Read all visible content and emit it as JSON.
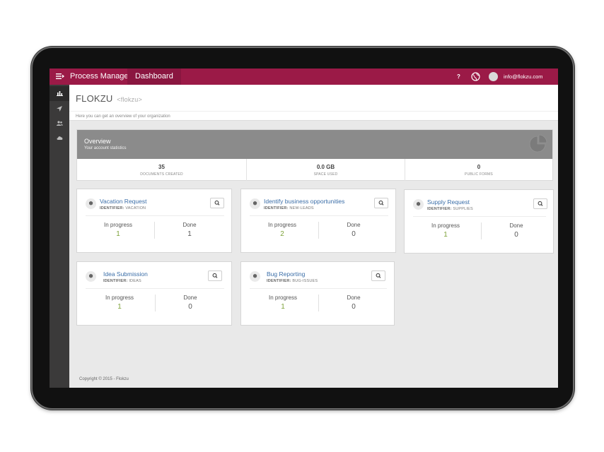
{
  "topbar": {
    "brand": "Process Manager",
    "nav_dashboard": "Dashboard",
    "help_label": "?",
    "user_email": "info@flokzu.com"
  },
  "sidebar": {
    "items": [
      {
        "icon": "bar-chart-icon",
        "glyph": "▥"
      },
      {
        "icon": "send-icon",
        "glyph": "➤"
      },
      {
        "icon": "users-icon",
        "glyph": "👥"
      },
      {
        "icon": "cloud-icon",
        "glyph": "☁"
      }
    ]
  },
  "header": {
    "org_name": "FLOKZU",
    "org_handle": "<flokzu>",
    "description": "Here you can get an overview of your organization"
  },
  "overview": {
    "title": "Overview",
    "subtitle": "Your account statistics",
    "stats": [
      {
        "value": "35",
        "label": "DOCUMENTS CREATED"
      },
      {
        "value": "0.0 GB",
        "label": "SPACE USED"
      },
      {
        "value": "0",
        "label": "PUBLIC FORMS"
      }
    ]
  },
  "processes": [
    {
      "title": "Vacation Request",
      "identifier_label": "IDENTIFIER:",
      "identifier": "VACATION",
      "in_progress_label": "In progress",
      "in_progress": "1",
      "done_label": "Done",
      "done": "1"
    },
    {
      "title": "Identify business opportunities",
      "identifier_label": "IDENTIFIER:",
      "identifier": "NEW-LEADS",
      "in_progress_label": "In progress",
      "in_progress": "2",
      "done_label": "Done",
      "done": "0"
    },
    {
      "title": "Supply Request",
      "identifier_label": "IDENTIFIER:",
      "identifier": "SUPPLIES",
      "in_progress_label": "In progress",
      "in_progress": "1",
      "done_label": "Done",
      "done": "0"
    },
    {
      "title": "Idea Submission",
      "identifier_label": "IDENTIFIER:",
      "identifier": "IDEAS",
      "in_progress_label": "In progress",
      "in_progress": "1",
      "done_label": "Done",
      "done": "0"
    },
    {
      "title": "Bug Reporting",
      "identifier_label": "IDENTIFIER:",
      "identifier": "BUG-ISSUES",
      "in_progress_label": "In progress",
      "in_progress": "1",
      "done_label": "Done",
      "done": "0"
    }
  ],
  "footer": {
    "copyright": "Copyright © 2015 - Flokzu"
  },
  "colors": {
    "topbar": "#9b1a47",
    "sidebar": "#3b3a3a",
    "link": "#3b6ea8",
    "in_progress": "#7ea33a"
  }
}
